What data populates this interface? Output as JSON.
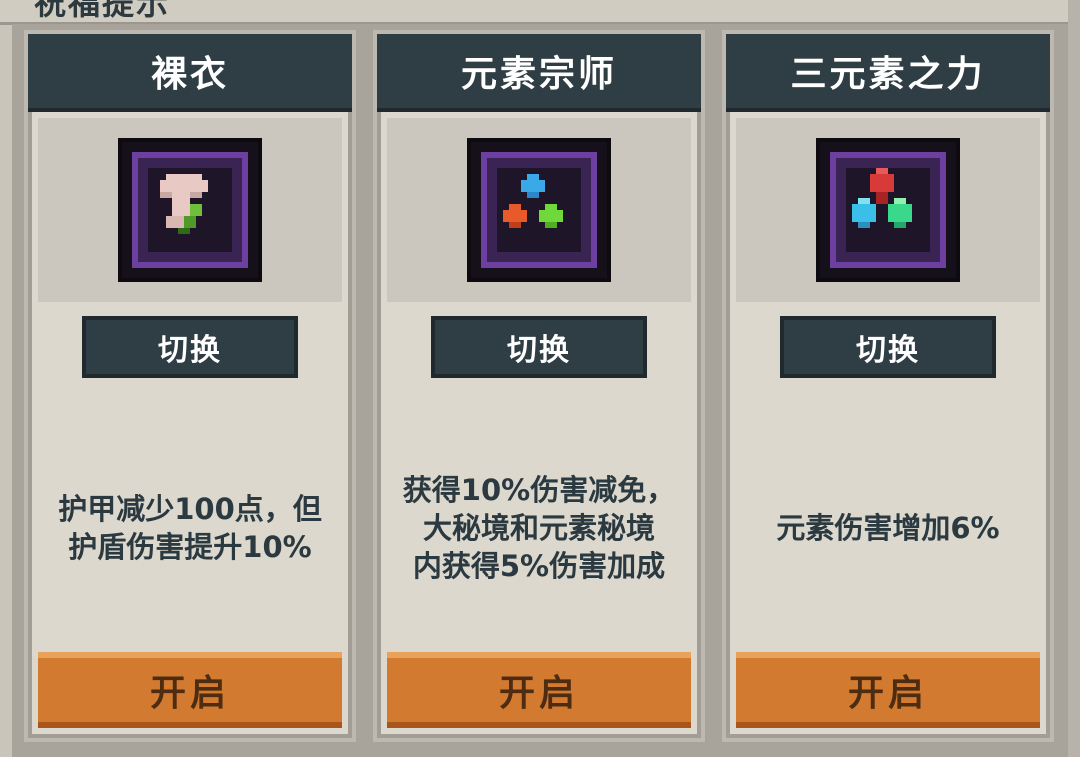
{
  "header": {
    "title": "祝福提示"
  },
  "cards": [
    {
      "title": "裸衣",
      "icon": "naked-body-icon",
      "switch_label": "切换",
      "description": "护甲减少100点，但\n护盾伤害提升10%",
      "open_label": "开启"
    },
    {
      "title": "元素宗师",
      "icon": "element-master-icon",
      "switch_label": "切换",
      "description": "获得10%伤害减免，\n大秘境和元素秘境\n内获得5%伤害加成",
      "open_label": "开启"
    },
    {
      "title": "三元素之力",
      "icon": "three-elements-icon",
      "switch_label": "切换",
      "description": "元素伤害增加6%",
      "open_label": "开启"
    }
  ],
  "colors": {
    "header_bg": "#2f3d44",
    "card_bg": "#ddd8cd",
    "open_button": "#d27a2f",
    "frame_purple": "#6c3fa0"
  }
}
